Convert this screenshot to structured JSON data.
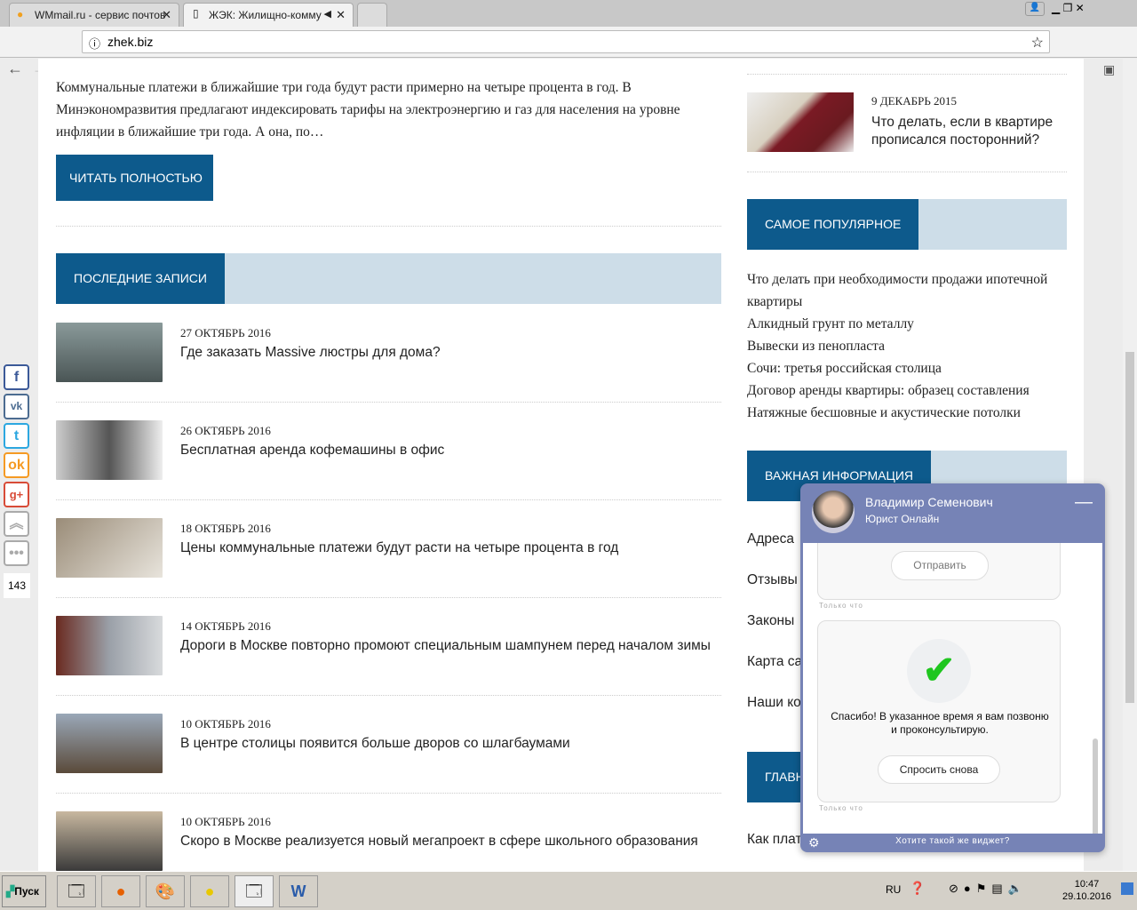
{
  "browser": {
    "tabs": [
      {
        "title": "WMmail.ru - сервис почтов",
        "active": false
      },
      {
        "title": "ЖЭК: Жилищно-комму",
        "active": true
      }
    ],
    "url": "zhek.biz"
  },
  "main": {
    "excerpt": "Коммунальные платежи в ближайшие три года будут расти примерно на четыре процента в год. В Минэкономразвития предлагают индексировать тарифы на электроэнергию и газ для населения на уровне инфляции в ближайшие три года. А она, по…",
    "read_more": "ЧИТАТЬ ПОЛНОСТЬЮ",
    "recent_title": "ПОСЛЕДНИЕ ЗАПИСИ",
    "posts": [
      {
        "date": "27 ОКТЯБРЬ 2016",
        "title": "Где заказать Massive люстры для дома?"
      },
      {
        "date": "26 ОКТЯБРЬ 2016",
        "title": "Бесплатная аренда кофемашины в офис"
      },
      {
        "date": "18 ОКТЯБРЬ 2016",
        "title": "Цены коммунальные платежи будут расти на четыре процента в год"
      },
      {
        "date": "14 ОКТЯБРЬ 2016",
        "title": "Дороги в Москве повторно промоют специальным шампунем перед началом зимы"
      },
      {
        "date": "10 ОКТЯБРЬ 2016",
        "title": "В центре столицы появится больше дворов со шлагбаумами"
      },
      {
        "date": "10 ОКТЯБРЬ 2016",
        "title": "Скоро в Москве реализуется новый мегапроект в сфере школьного образования"
      }
    ]
  },
  "sidebar": {
    "top_post": {
      "date": "9 ДЕКАБРЬ 2015",
      "title": "Что делать, если в квартире прописался посторонний?"
    },
    "popular_title": "САМОЕ ПОПУЛЯРНОЕ",
    "popular": [
      "Что делать при необходимости продажи ипотечной квартиры",
      "Алкидный грунт по металлу",
      "Вывески из пенопласта",
      "Сочи: третья российская столица",
      "Договор аренды квартиры: образец составления",
      "Натяжные бесшовные и акустические потолки"
    ],
    "info_title": "ВАЖНАЯ ИНФОРМАЦИЯ",
    "info_links": [
      "Адреса",
      "Отзывы",
      "Законы",
      "Карта са",
      "Наши ко"
    ],
    "main_title": "ГЛАВН",
    "bottom_link": "Как плат"
  },
  "share": {
    "count": "143"
  },
  "chat": {
    "name": "Владимир Семенович",
    "role": "Юрист Онлайн",
    "send": "Отправить",
    "time": "Только что",
    "thanks": "Спасибо! В указанное время я вам позвоню и проконсультирую.",
    "ask_again": "Спросить снова",
    "footer": "Хотите такой же виджет?"
  },
  "taskbar": {
    "start": "Пуск",
    "lang": "RU",
    "time": "10:47",
    "date": "29.10.2016"
  },
  "colors": {
    "accent": "#0d5a8c",
    "accent_light": "#cddde8",
    "chat": "#7683b6"
  }
}
